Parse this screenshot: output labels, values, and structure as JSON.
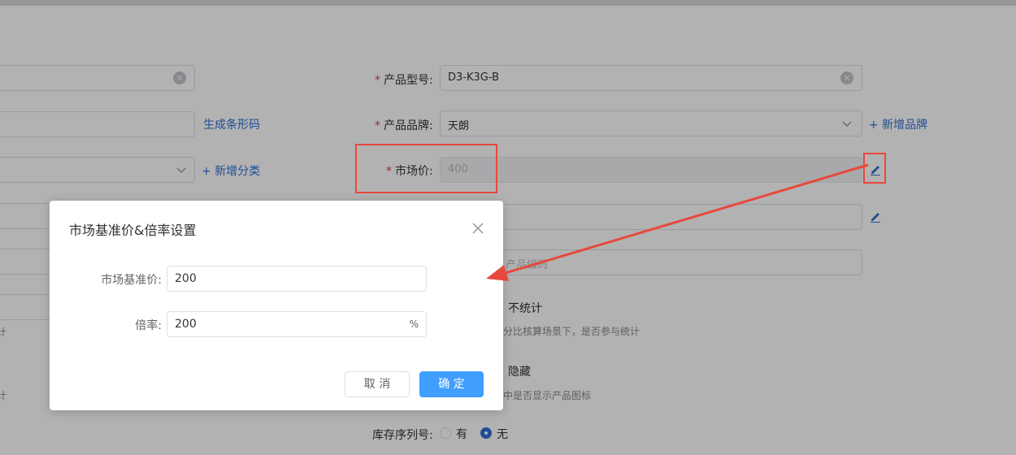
{
  "form": {
    "model_label": "产品型号:",
    "model_value": "D3-K3G-B",
    "barcode_link": "生成条形码",
    "brand_label": "产品品牌:",
    "brand_value": "天朗",
    "add_brand_link": "+ 新增品牌",
    "add_category_link": "+ 新增分类",
    "market_price_label": "市场价:",
    "market_price_value": "400",
    "abbr_placeholder": "产品编码",
    "stat_option": "不统计",
    "stat_hint": "分比核算场景下，是否参与统计",
    "hide_option": "隐藏",
    "hide_hint": "中是否显示产品图标",
    "left_hint_fragment": "计",
    "left_hint_fragment2": "计",
    "serial_label": "库存序列号:",
    "serial_yes": "有",
    "serial_no": "无"
  },
  "dialog": {
    "title": "市场基准价&倍率设置",
    "base_price_label": "市场基准价:",
    "base_price_value": "200",
    "rate_label": "倍率:",
    "rate_value": "200",
    "rate_suffix": "%",
    "cancel_label": "取 消",
    "ok_label": "确 定"
  },
  "colors": {
    "annotation": "#e8483d",
    "primary": "#409eff",
    "link": "#2f6fd6"
  }
}
